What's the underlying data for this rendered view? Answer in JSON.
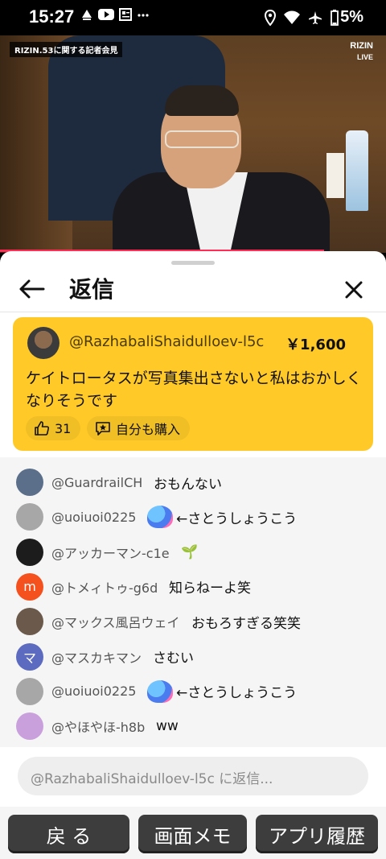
{
  "status_bar": {
    "time": "15:27",
    "battery": "5%",
    "icons": [
      "notification-icon",
      "youtube-icon",
      "news-icon",
      "more-icon",
      "location-icon",
      "wifi-icon",
      "airplane-icon",
      "battery-icon"
    ]
  },
  "video": {
    "banner": "RIZIN.53に関する記者会見",
    "logo": "RIZIN",
    "live": "LIVE",
    "progress": 0.84
  },
  "header": {
    "title": "返信"
  },
  "superchat": {
    "author": "@RazhabaliShaidulloev-l5c",
    "amount": "￥1,600",
    "message": "ケイトロータスが写真集出さないと私はおかしくなりそうです",
    "likes": "31",
    "buy_label": "自分も購入"
  },
  "chat": [
    {
      "author": "@GuardrailCH",
      "message": "おもんない",
      "avatar_color": "#5b6f8a",
      "avatar_text": "",
      "emoji": false
    },
    {
      "author": "@uoiuoi0225",
      "message": "←さとうしょうこう",
      "avatar_color": "#a7a7a7",
      "avatar_text": "",
      "emoji": true
    },
    {
      "author": "@アッカーマン-c1e",
      "message": "🌱",
      "avatar_color": "#1c1c1c",
      "avatar_text": "",
      "emoji": false
    },
    {
      "author": "@トメィトゥ-g6d",
      "message": "知らねーよ笑",
      "avatar_color": "#f4511e",
      "avatar_text": "m",
      "emoji": false
    },
    {
      "author": "@マックス風呂ウェイ",
      "message": "おもろすぎる笑笑",
      "avatar_color": "#6b5a4b",
      "avatar_text": "",
      "emoji": false
    },
    {
      "author": "@マスカキマン",
      "message": "さむい",
      "avatar_color": "#5c6bc0",
      "avatar_text": "マ",
      "emoji": false
    },
    {
      "author": "@uoiuoi0225",
      "message": "←さとうしょうこう",
      "avatar_color": "#a7a7a7",
      "avatar_text": "",
      "emoji": true
    },
    {
      "author": "@やほやほ-h8b",
      "message": "ww",
      "avatar_color": "#c9a0dc",
      "avatar_text": "",
      "emoji": false
    }
  ],
  "reply": {
    "placeholder": "@RazhabaliShaidulloev-l5c に返信..."
  },
  "nav": {
    "back": "戻 る",
    "memo": "画面メモ",
    "history": "アプリ履歴"
  }
}
